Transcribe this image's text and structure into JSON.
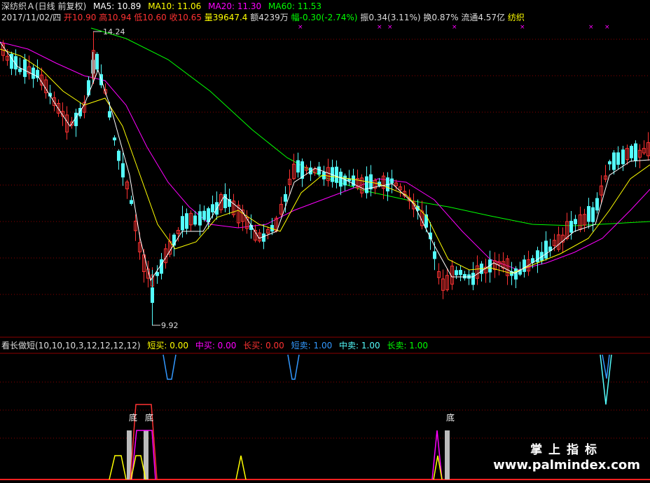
{
  "header": {
    "stock_name": "深纺织Ａ(日线 前复权)",
    "ma5_label": "MA5: 10.89",
    "ma10_label": "MA10: 11.06",
    "ma20_label": "MA20: 11.30",
    "ma60_label": "MA60: 11.53",
    "colors": {
      "ma5": "#ffffff",
      "ma10": "#ffff00",
      "ma20": "#ff00ff",
      "ma60": "#00ff00",
      "name": "#dddddd"
    }
  },
  "info": {
    "date": "2017/11/02/四",
    "open_label": "开10.90",
    "high_label": "高10.94",
    "low_label": "低10.60",
    "close_label": "收10.65",
    "volume_label": "量39647.4",
    "amount_label": "额4239万",
    "change_label": "幅-0.30(-2.74%)",
    "amplitude_label": "振0.34(3.11%)",
    "turnover_label": "换0.87%",
    "float_label": "流通4.57亿",
    "industry_label": "纺织"
  },
  "price_chart": {
    "high_label": "14.24",
    "low_label": "9.92",
    "colors": {
      "up": "#ff3232",
      "down": "#54fcfc",
      "grid": "#8b0000",
      "marker": "#ff00ff"
    }
  },
  "indicator": {
    "name": "看长做短(10,10,10,3,12,12,12,12)",
    "short_buy_label": "短买: 0.00",
    "mid_buy_label": "中买: 0.00",
    "long_buy_label": "长买: 0.00",
    "short_sell_label": "短卖: 1.00",
    "mid_sell_label": "中卖: 1.00",
    "long_sell_label": "长卖: 1.00",
    "bottom_label_1": "底",
    "bottom_label_2": "底",
    "bottom_label_3": "底",
    "colors": {
      "short_buy": "#ffff00",
      "mid_buy": "#ff00ff",
      "long_buy": "#ff3232",
      "short_sell": "#3399ff",
      "mid_sell": "#54fcfc",
      "long_sell": "#00ff00"
    }
  },
  "watermark": {
    "cn": "掌上指标",
    "url": "www.palmindex.com"
  }
}
